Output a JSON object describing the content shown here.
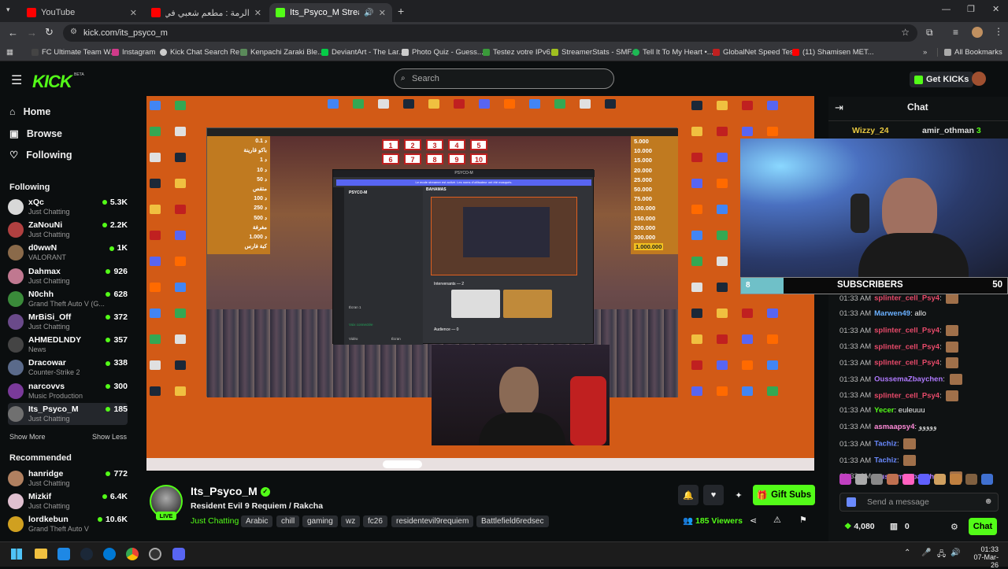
{
  "tabs": [
    {
      "title": "YouTube",
      "color": "#ff0000"
    },
    {
      "title": "الرمة : مطعم شعبي في طريق",
      "color": "#ff0000"
    },
    {
      "title": "Its_Psyco_M Stream - Watc",
      "color": "#53fc18"
    }
  ],
  "address": {
    "url": "kick.com/its_psyco_m"
  },
  "bookmarks": [
    "FC Ultimate Team W...",
    "Instagram",
    "Kick Chat Search Re...",
    "Kenpachi Zaraki Ble...",
    "DeviantArt - The Lar...",
    "Photo Quiz - Guess...",
    "Testez votre IPv6.",
    "StreamerStats - SMF...",
    "Tell It To My Heart •...",
    "GlobalNet Speed Test",
    "(11) Shamisen MET...",
    "All Bookmarks"
  ],
  "header": {
    "logo": "KICK",
    "beta": "BETA",
    "search_placeholder": "Search",
    "get_kicks": "Get KICKs"
  },
  "nav": {
    "home": "Home",
    "browse": "Browse",
    "following": "Following"
  },
  "sidebar": {
    "following_heading": "Following",
    "following": [
      {
        "name": "xQc",
        "category": "Just Chatting",
        "viewers": "5.3K",
        "color": "#d8d8d8"
      },
      {
        "name": "ZaNouNi",
        "category": "Just Chatting",
        "viewers": "2.2K",
        "color": "#b04040"
      },
      {
        "name": "d0wwN",
        "category": "VALORANT",
        "viewers": "1K",
        "color": "#8a6a4a"
      },
      {
        "name": "Dahmax",
        "category": "Just Chatting",
        "viewers": "926",
        "color": "#c07890"
      },
      {
        "name": "N0chh",
        "category": "Grand Theft Auto V (G...",
        "viewers": "628",
        "color": "#3a8a3a"
      },
      {
        "name": "MrBiSi_Off",
        "category": "Just Chatting",
        "viewers": "372",
        "color": "#6a4a8a"
      },
      {
        "name": "AHMEDLNDY",
        "category": "News",
        "viewers": "357",
        "color": "#444"
      },
      {
        "name": "Dracowar",
        "category": "Counter-Strike 2",
        "viewers": "338",
        "color": "#5a6a8a"
      },
      {
        "name": "narcovvs",
        "category": "Music Production",
        "viewers": "300",
        "color": "#7a3a9a"
      },
      {
        "name": "Its_Psyco_M",
        "category": "Just Chatting",
        "viewers": "185",
        "color": "#707070"
      }
    ],
    "show_more": "Show More",
    "show_less": "Show Less",
    "recommended_heading": "Recommended",
    "recommended": [
      {
        "name": "hanridge",
        "category": "Just Chatting",
        "viewers": "772",
        "color": "#b08060"
      },
      {
        "name": "Mizkif",
        "category": "Just Chatting",
        "viewers": "6.4K",
        "color": "#e0c0d0"
      },
      {
        "name": "lordkebun",
        "category": "Grand Theft Auto V",
        "viewers": "10.6K",
        "color": "#d0a020"
      }
    ]
  },
  "video": {
    "arabic_left": [
      "د 0.1",
      "باكو قارينة",
      "د 1",
      "د 10",
      "د 50",
      "متقص",
      "د 100",
      "د 250",
      "د 500",
      "مغرفة",
      "د 1.000",
      "كبة فارس"
    ],
    "right_values": [
      "5.000",
      "10.000",
      "15.000",
      "20.000",
      "25.000",
      "50.000",
      "75.000",
      "100.000",
      "150.000",
      "200.000",
      "300.000",
      "1.000.000"
    ],
    "grid_numbers": [
      "1",
      "2",
      "3",
      "4",
      "5",
      "6",
      "7",
      "8",
      "9",
      "10"
    ],
    "discord": {
      "server": "PSYCO-M",
      "channel": "BAHAMAS",
      "banner": "Le mode streamer est activé. Les noms d'utilisateur ont été masqués.",
      "intervenants": "Intervenants — 2",
      "audience": "Audience — 0",
      "screen": "Écran 1",
      "voice": "Voix connectée",
      "video": "Vidéo",
      "ecran": "Écran"
    },
    "overlay": {
      "subscribers_label": "SUBSCRIBERS",
      "subs_progress": 8,
      "subs_goal": 50
    }
  },
  "stream": {
    "name": "Its_Psyco_M",
    "live": "LIVE",
    "title": "Resident Evil 9 Requiem  / Rakcha",
    "category": "Just Chatting",
    "tags": [
      "Arabic",
      "chill",
      "gaming",
      "wz",
      "fc26",
      "residentevil9requiem",
      "Battlefield6redsec"
    ],
    "viewers": "185 Viewers",
    "gift_subs": "Gift Subs"
  },
  "chat": {
    "title": "Chat",
    "pinned": {
      "user1": "Wizzy_24",
      "user2": "amir_othman",
      "count": "3"
    },
    "messages": [
      {
        "time": "01:33 AM",
        "user": "splinter_cell_Psy4",
        "color": "#e84a6a",
        "text": ""
      },
      {
        "time": "01:33 AM",
        "user": "Marwen49",
        "color": "#6ab0ff",
        "text": "allo"
      },
      {
        "time": "01:33 AM",
        "user": "splinter_cell_Psy4",
        "color": "#e84a6a",
        "text": ""
      },
      {
        "time": "01:33 AM",
        "user": "splinter_cell_Psy4",
        "color": "#e84a6a",
        "text": ""
      },
      {
        "time": "01:33 AM",
        "user": "splinter_cell_Psy4",
        "color": "#e84a6a",
        "text": ""
      },
      {
        "time": "01:33 AM",
        "user": "OussemaZbaychen",
        "color": "#b07aff",
        "text": ""
      },
      {
        "time": "01:33 AM",
        "user": "splinter_cell_Psy4",
        "color": "#e84a6a",
        "text": ""
      },
      {
        "time": "01:33 AM",
        "user": "Yecer",
        "color": "#53fc18",
        "text": "euleuuu"
      },
      {
        "time": "01:33 AM",
        "user": "asmaapsy4",
        "color": "#ff8ad8",
        "text": "ووووو"
      },
      {
        "time": "01:33 AM",
        "user": "Tachiz",
        "color": "#6a8aff",
        "text": ""
      },
      {
        "time": "01:33 AM",
        "user": "Tachiz",
        "color": "#6a8aff",
        "text": ""
      },
      {
        "time": "01:33 AM",
        "user": "OussemaZbaychen",
        "color": "#b07aff",
        "text": ""
      }
    ],
    "send_placeholder": "Send a message",
    "points": "4,080",
    "tickets": "0",
    "chat_button": "Chat"
  },
  "taskbar": {
    "time": "01:33",
    "date": "07-Mar-26"
  }
}
